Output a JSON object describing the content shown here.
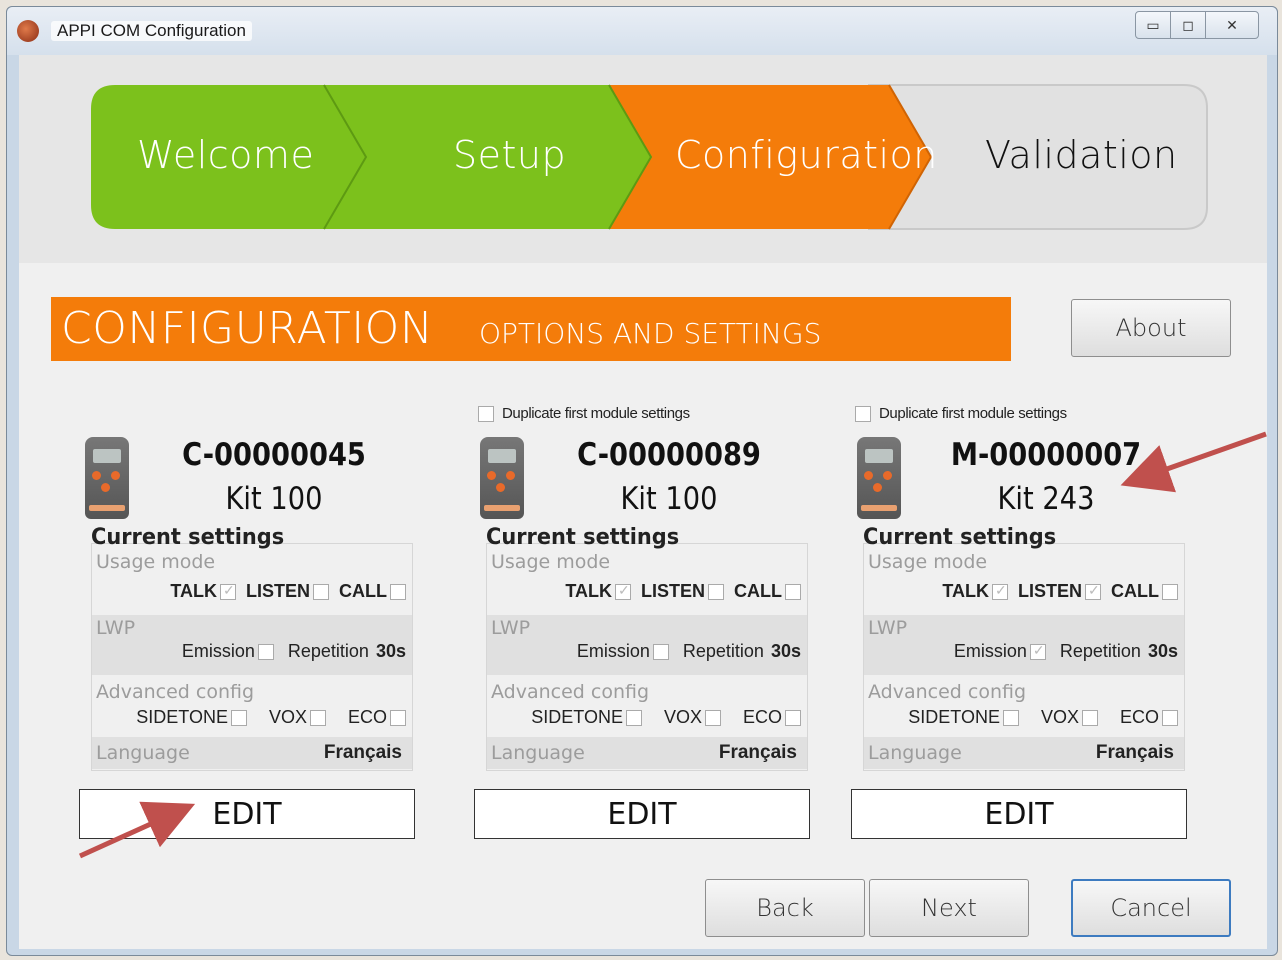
{
  "window": {
    "title": "APPI COM Configuration",
    "controls": {
      "minimize": "▭",
      "maximize": "◻",
      "close": "✕"
    }
  },
  "wizard": {
    "steps": [
      {
        "label": "Welcome",
        "state": "done",
        "color": "#7cc11c"
      },
      {
        "label": "Setup",
        "state": "done",
        "color": "#7cc11c"
      },
      {
        "label": "Configuration",
        "state": "current",
        "color": "#f47c0a"
      },
      {
        "label": "Validation",
        "state": "pending",
        "color": "#e1e1e1"
      }
    ]
  },
  "header": {
    "title": "CONFIGURATION",
    "subtitle": "OPTIONS AND SETTINGS",
    "color": "#f47c0a"
  },
  "about_label": "About",
  "modules": [
    {
      "duplicate_label": "",
      "show_duplicate": false,
      "serial": "C-00000045",
      "kit": "Kit 100",
      "current_settings": "Current settings",
      "usage_mode": "Usage mode",
      "talk": "TALK",
      "talk_checked": true,
      "listen": "LISTEN",
      "listen_checked": false,
      "call": "CALL",
      "call_checked": false,
      "lwp": "LWP",
      "emission": "Emission",
      "emission_checked": false,
      "repetition_label": "Repetition",
      "repetition_value": "30s",
      "advanced": "Advanced config",
      "sidetone": "SIDETONE",
      "sidetone_checked": false,
      "vox": "VOX",
      "vox_checked": false,
      "eco": "ECO",
      "eco_checked": false,
      "language_label": "Language",
      "language_value": "Français",
      "edit": "EDIT"
    },
    {
      "duplicate_label": "Duplicate first module settings",
      "show_duplicate": true,
      "serial": "C-00000089",
      "kit": "Kit 100",
      "current_settings": "Current settings",
      "usage_mode": "Usage mode",
      "talk": "TALK",
      "talk_checked": true,
      "listen": "LISTEN",
      "listen_checked": false,
      "call": "CALL",
      "call_checked": false,
      "lwp": "LWP",
      "emission": "Emission",
      "emission_checked": false,
      "repetition_label": "Repetition",
      "repetition_value": "30s",
      "advanced": "Advanced config",
      "sidetone": "SIDETONE",
      "sidetone_checked": false,
      "vox": "VOX",
      "vox_checked": false,
      "eco": "ECO",
      "eco_checked": false,
      "language_label": "Language",
      "language_value": "Français",
      "edit": "EDIT"
    },
    {
      "duplicate_label": "Duplicate first module settings",
      "show_duplicate": true,
      "serial": "M-00000007",
      "kit": "Kit 243",
      "current_settings": "Current settings",
      "usage_mode": "Usage mode",
      "talk": "TALK",
      "talk_checked": true,
      "listen": "LISTEN",
      "listen_checked": true,
      "call": "CALL",
      "call_checked": false,
      "lwp": "LWP",
      "emission": "Emission",
      "emission_checked": true,
      "repetition_label": "Repetition",
      "repetition_value": "30s",
      "advanced": "Advanced config",
      "sidetone": "SIDETONE",
      "sidetone_checked": false,
      "vox": "VOX",
      "vox_checked": false,
      "eco": "ECO",
      "eco_checked": false,
      "language_label": "Language",
      "language_value": "Français",
      "edit": "EDIT"
    }
  ],
  "footer": {
    "back": "Back",
    "next": "Next",
    "cancel": "Cancel"
  },
  "annotation_color": "#c0504d"
}
